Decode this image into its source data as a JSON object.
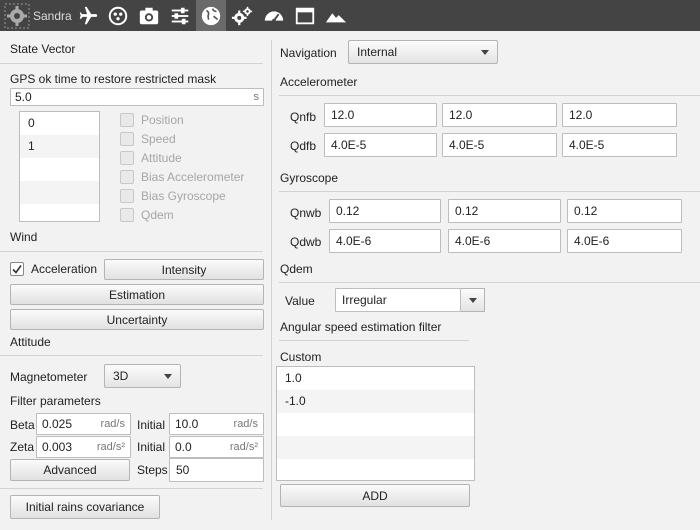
{
  "toolbar": {
    "brand": "Sandra",
    "icons": [
      "gear-icon",
      "airplane-icon",
      "satellite-icon",
      "camera-icon",
      "sliders-icon",
      "globe-icon",
      "gears-icon",
      "dashboard-icon",
      "window-icon",
      "mountain-icon"
    ],
    "active": "globe-icon"
  },
  "left": {
    "state_vector_title": "State Vector",
    "gps_label": "GPS ok time to restore restricted mask",
    "gps_value": "5.0",
    "gps_unit": "s",
    "state_list": [
      "0",
      "1",
      "",
      "",
      ""
    ],
    "state_checks": [
      "Position",
      "Speed",
      "Attitude",
      "Bias Accelerometer",
      "Bias Gyroscope",
      "Qdem"
    ],
    "wind_title": "Wind",
    "acceleration_label": "Acceleration",
    "intensity_label": "Intensity",
    "estimation_label": "Estimation",
    "uncertainty_label": "Uncertainty",
    "attitude_title": "Attitude",
    "magnetometer_label": "Magnetometer",
    "magnetometer_value": "3D",
    "filter_title": "Filter parameters",
    "beta_label": "Beta",
    "beta_value": "0.025",
    "beta_unit": "rad/s",
    "initial1_label": "Initial",
    "initial1_value": "10.0",
    "initial1_unit": "rad/s",
    "zeta_label": "Zeta",
    "zeta_value": "0.003",
    "zeta_unit": "rad/s²",
    "initial2_label": "Initial",
    "initial2_value": "0.0",
    "initial2_unit": "rad/s²",
    "advanced_label": "Advanced",
    "steps_label": "Steps",
    "steps_value": "50",
    "initial_rains_label": "Initial rains covariance"
  },
  "right": {
    "navigation_label": "Navigation",
    "navigation_value": "Internal",
    "accel_title": "Accelerometer",
    "qnfb_label": "Qnfb",
    "qnfb_values": [
      "12.0",
      "12.0",
      "12.0"
    ],
    "qdfb_label": "Qdfb",
    "qdfb_values": [
      "4.0E-5",
      "4.0E-5",
      "4.0E-5"
    ],
    "gyro_title": "Gyroscope",
    "qnwb_label": "Qnwb",
    "qnwb_values": [
      "0.12",
      "0.12",
      "0.12"
    ],
    "qdwb_label": "Qdwb",
    "qdwb_values": [
      "4.0E-6",
      "4.0E-6",
      "4.0E-6"
    ],
    "qdem_title": "Qdem",
    "value_label": "Value",
    "value_value": "Irregular",
    "angular_title": "Angular speed estimation filter",
    "custom_label": "Custom",
    "custom_list": [
      "1.0",
      "-1.0",
      "",
      "",
      ""
    ],
    "add_label": "ADD"
  }
}
